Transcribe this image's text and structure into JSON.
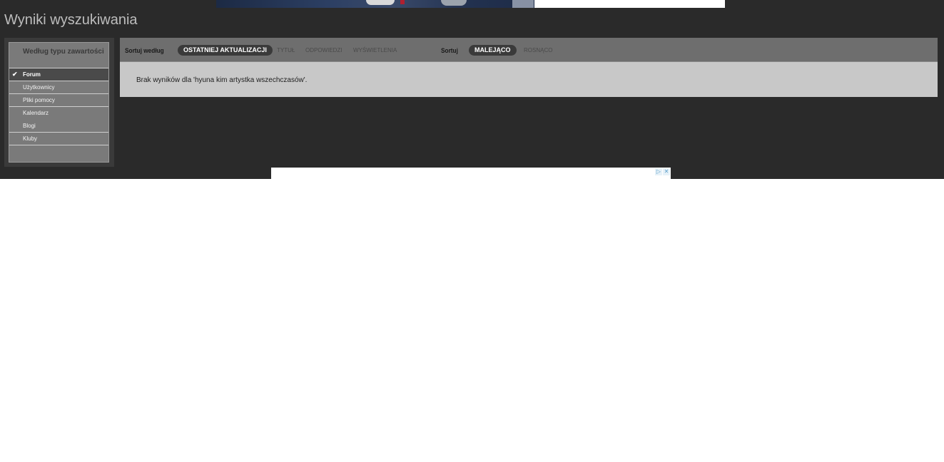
{
  "page": {
    "title": "Wyniki wyszukiwania"
  },
  "sidebar": {
    "header": "Według typu zawartości",
    "items": [
      {
        "label": "Forum",
        "selected": true
      },
      {
        "label": "Użytkownicy",
        "selected": false
      },
      {
        "label": "Pliki pomocy",
        "selected": false
      },
      {
        "label": "Kalendarz",
        "selected": false
      },
      {
        "label": "Blogi",
        "selected": false
      },
      {
        "label": "Kluby",
        "selected": false
      }
    ]
  },
  "sort": {
    "sort_by_label": "Sortuj według",
    "options": [
      "OSTATNIEJ AKTUALIZACJI",
      "TYTUŁ",
      "ODPOWIEDZI",
      "WYŚWIETLENIA"
    ],
    "active_option": "OSTATNIEJ AKTUALIZACJI",
    "order_label": "Sortuj",
    "orders": [
      "MALEJĄCO",
      "ROSNĄCO"
    ],
    "active_order": "MALEJĄCO"
  },
  "results": {
    "message": "Brak wyników dla 'hyuna kim artystka wszechczasów'."
  },
  "ad": {
    "icons": [
      "adchoices-icon",
      "close-icon"
    ]
  },
  "colors": {
    "background": "#2a2a2a",
    "panel": "#c8c8c8",
    "sort_bar": "#6e6e6e",
    "pill": "#3a3a3a"
  }
}
